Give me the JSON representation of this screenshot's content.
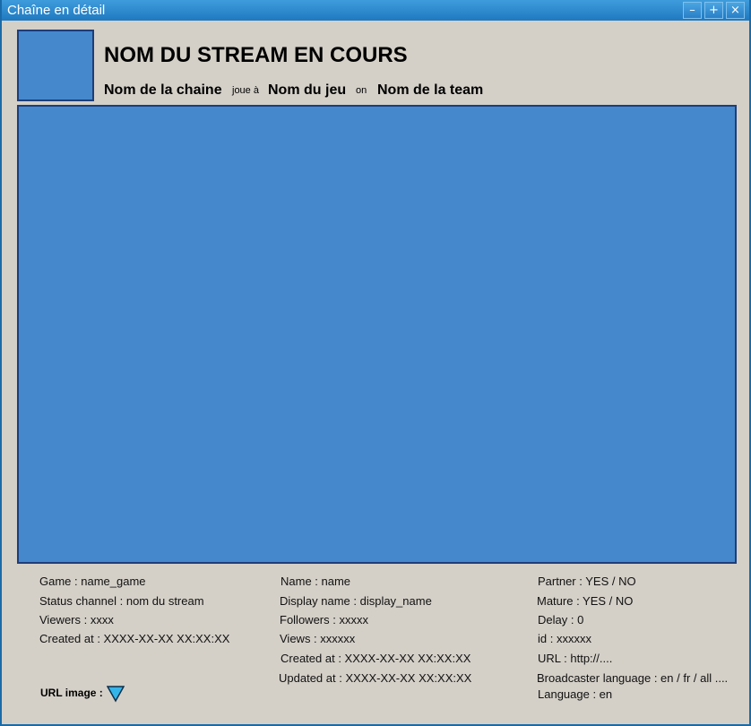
{
  "window": {
    "title": "Chaîne en détail",
    "min_glyph": "–",
    "max_glyph": "+",
    "close_glyph": "×"
  },
  "header": {
    "stream_title": "NOM DU STREAM EN COURS",
    "channel_name": "Nom de la chaine",
    "plays_word": "joue à",
    "game_name": "Nom du jeu",
    "on_word": "on",
    "team_name": "Nom de la team"
  },
  "info": {
    "col1": [
      "Game : name_game",
      "Status channel : nom du stream",
      "Viewers : xxxx",
      "Created at : XXXX-XX-XX XX:XX:XX"
    ],
    "col2": [
      "Name : name",
      "Display name : display_name",
      "Followers : xxxxx",
      "Views : xxxxxx",
      "Created at : XXXX-XX-XX XX:XX:XX",
      "Updated at : XXXX-XX-XX XX:XX:XX"
    ],
    "col3": [
      "Partner : YES / NO",
      "Mature : YES / NO",
      "Delay : 0",
      "id : xxxxxx",
      "URL : http://....",
      "Broadcaster language : en / fr / all ....",
      "Language : en"
    ]
  },
  "url_image": {
    "label": "URL image :",
    "icon": "triangle-down-icon"
  },
  "colors": {
    "titlebar": "#2a86cf",
    "placeholder_fill": "#4588cc",
    "placeholder_border": "#1e3d7a",
    "background": "#d4d0c8",
    "dropdown_icon": "#33b5ea"
  }
}
